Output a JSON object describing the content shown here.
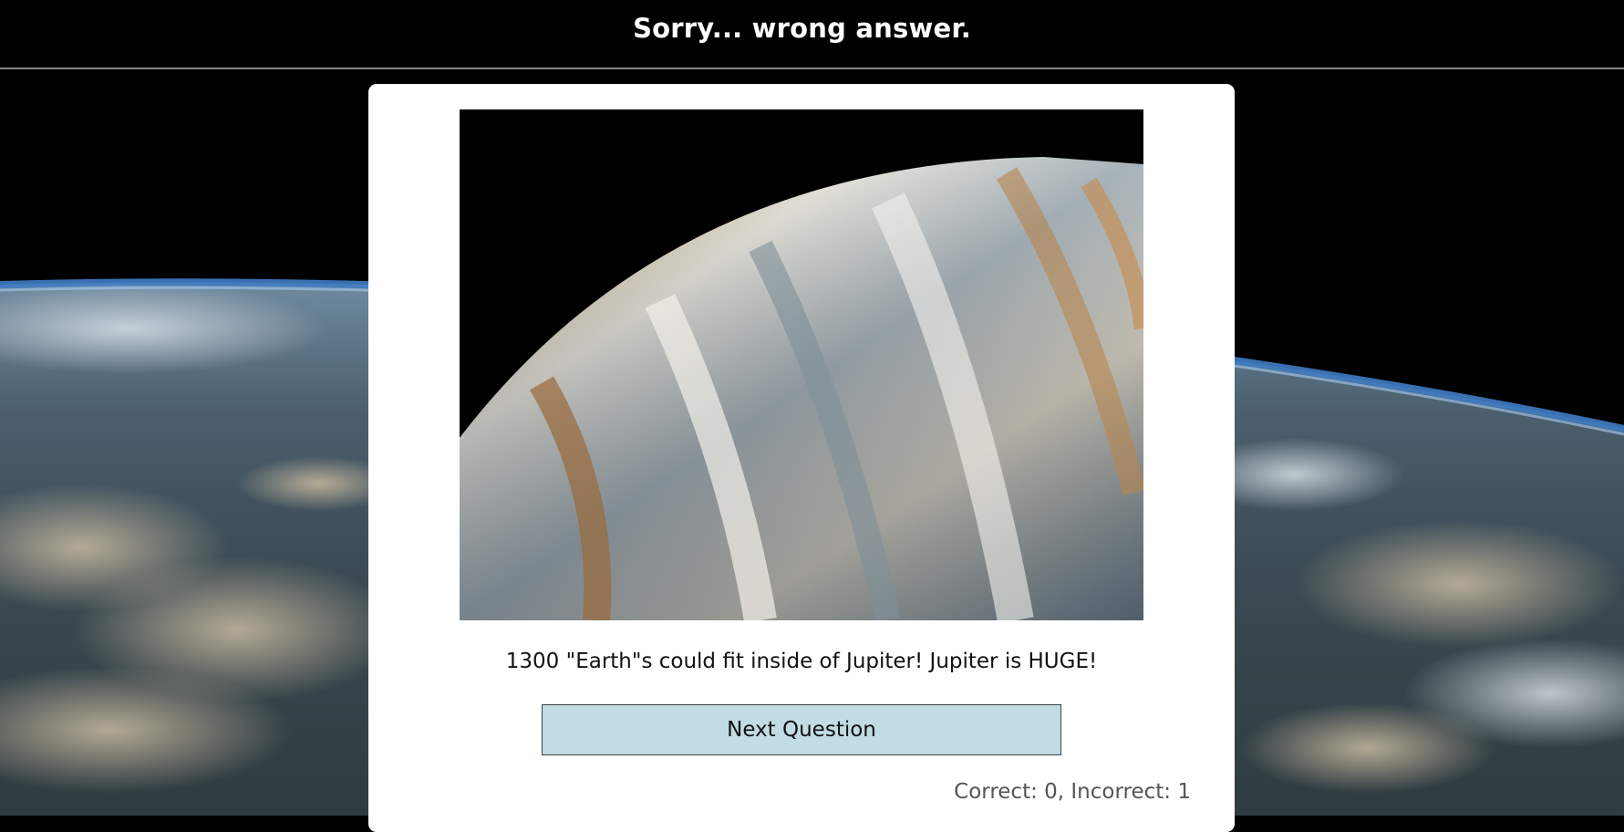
{
  "header": {
    "title": "Sorry... wrong answer."
  },
  "card": {
    "fact_text": "1300 \"Earth\"s could fit inside of Jupiter! Jupiter is HUGE!",
    "next_button_label": "Next Question",
    "score_text": "Correct: 0, Incorrect: 1"
  },
  "colors": {
    "header_bg": "#000000",
    "header_text": "#ffffff",
    "card_bg": "#ffffff",
    "button_bg": "#c2dce4",
    "button_border": "#39454a",
    "score_text": "#555555"
  },
  "images": {
    "background": "earth-from-orbit",
    "card_image": "jupiter-closeup"
  }
}
